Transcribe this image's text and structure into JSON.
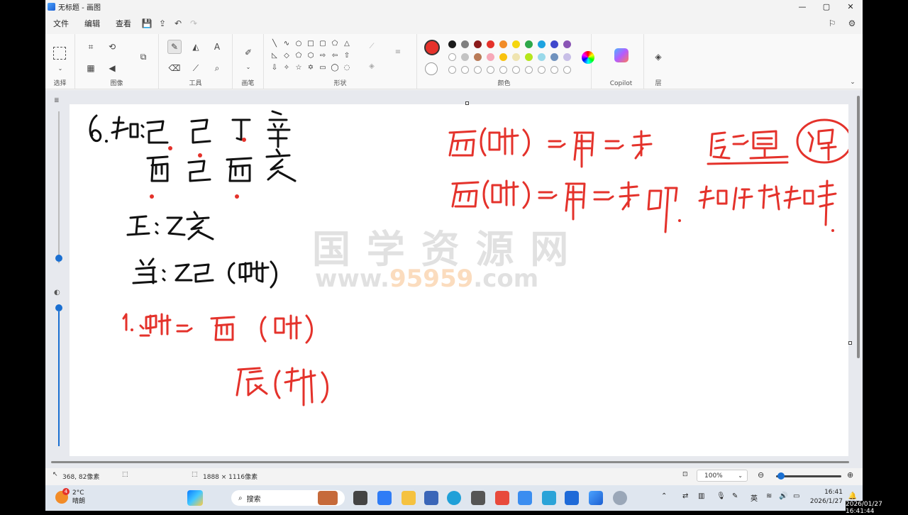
{
  "window": {
    "title": "无标题 - 画图",
    "minimize": "—",
    "maximize": "▢",
    "close": "✕"
  },
  "menu": {
    "file": "文件",
    "edit": "编辑",
    "view": "查看"
  },
  "ribbon": {
    "groups": {
      "select": "选择",
      "image": "图像",
      "tools": "工具",
      "brushes": "画笔",
      "shapes": "形状",
      "colors": "颜色",
      "copilot": "Copilot",
      "layers": "层"
    },
    "palette_row1": [
      "#1a1a1a",
      "#7f7f7f",
      "#8b1a1a",
      "#e5322b",
      "#f28c28",
      "#f5d60f",
      "#2da84a",
      "#1ea3e0",
      "#3f48cc",
      "#8a55b5"
    ],
    "palette_row2": [
      "#ffffff",
      "#c3c3c3",
      "#b97a57",
      "#f7a8b8",
      "#f9c20e",
      "#efe4b0",
      "#b5e61d",
      "#99d9ea",
      "#7092be",
      "#c8bfe7"
    ],
    "primary_color": "#e5322b"
  },
  "status": {
    "cursor_pos": "368, 82像素",
    "canvas_size": "1888 × 1116像素",
    "zoom": "100%"
  },
  "watermark": {
    "line1": "国 学 资 源 网",
    "line2_pre": "www.",
    "line2_num": "95959",
    "line2_post": ".com"
  },
  "taskbar": {
    "weather_temp": "2°C",
    "weather_desc": "晴朗",
    "badge": "4",
    "search_placeholder": "搜索",
    "ime": "英",
    "time": "16:41",
    "date": "2026/1/27",
    "stamp": "2026/01/27 16:41:44"
  }
}
